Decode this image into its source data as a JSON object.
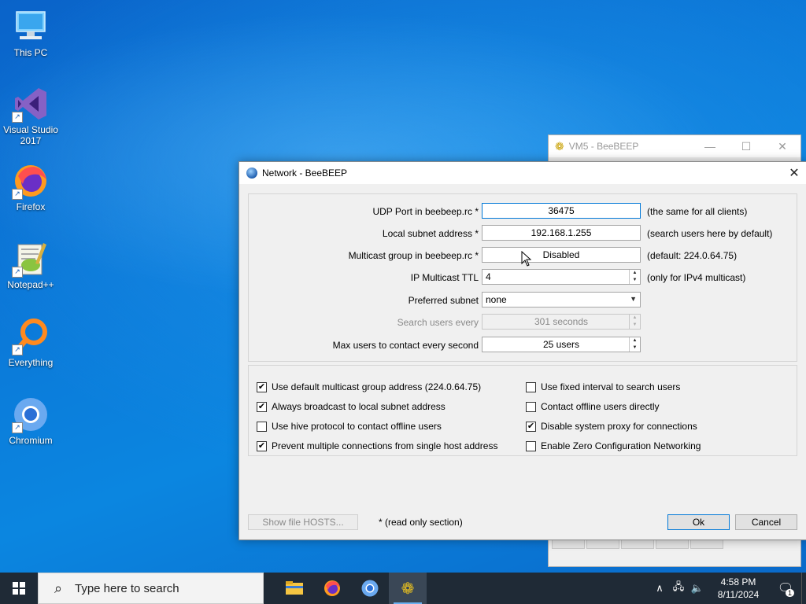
{
  "desktop": {
    "icons": [
      {
        "label_line1": "This PC",
        "label_line2": ""
      },
      {
        "label_line1": "Visual Studio",
        "label_line2": "2017"
      },
      {
        "label_line1": "Firefox",
        "label_line2": ""
      },
      {
        "label_line1": "Notepad++",
        "label_line2": ""
      },
      {
        "label_line1": "Everything",
        "label_line2": ""
      },
      {
        "label_line1": "Chromium",
        "label_line2": ""
      }
    ]
  },
  "background_window": {
    "title": "VM5 - BeeBEEP",
    "minimize": "—",
    "maximize": "☐",
    "close": "✕"
  },
  "dialog": {
    "title": "Network - BeeBEEP",
    "close": "✕",
    "rows": {
      "udp_label": "UDP Port in beebeep.rc *",
      "udp_value": "36475",
      "udp_hint": "(the same for all clients)",
      "subnet_label": "Local subnet address *",
      "subnet_value": "192.168.1.255",
      "subnet_hint": "(search users here by default)",
      "multicast_label": "Multicast group in beebeep.rc *",
      "multicast_value": "Disabled",
      "multicast_hint": "(default: 224.0.64.75)",
      "ttl_label": "IP Multicast TTL",
      "ttl_value": "4",
      "ttl_hint": "(only for IPv4 multicast)",
      "preferred_label": "Preferred subnet",
      "preferred_value": "none",
      "search_label": "Search users every",
      "search_value": "301 seconds",
      "max_label": "Max users to contact every second",
      "max_value": "25 users"
    },
    "options": {
      "opt1": {
        "label": "Use default multicast group address (224.0.64.75)",
        "mark": "✔"
      },
      "opt2": {
        "label": "Always broadcast to local subnet address",
        "mark": "✔"
      },
      "opt3": {
        "label": "Use hive protocol to contact offline users",
        "mark": ""
      },
      "opt4": {
        "label": "Prevent multiple connections from single host address",
        "mark": "✔"
      },
      "opt5": {
        "label": "Use fixed interval to search users",
        "mark": ""
      },
      "opt6": {
        "label": "Contact offline users directly",
        "mark": ""
      },
      "opt7": {
        "label": "Disable system proxy for connections",
        "mark": "✔"
      },
      "opt8": {
        "label": "Enable Zero Configuration Networking",
        "mark": ""
      }
    },
    "buttons": {
      "hosts": "Show file HOSTS...",
      "note": "* (read only section)",
      "ok": "Ok",
      "cancel": "Cancel"
    }
  },
  "taskbar": {
    "search_placeholder": "Type here to search",
    "time": "4:58 PM",
    "date": "8/11/2024",
    "notification_count": "1"
  }
}
